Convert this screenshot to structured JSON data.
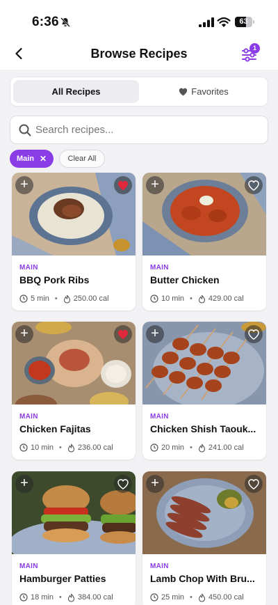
{
  "status_bar": {
    "time": "6:36",
    "battery": "63",
    "battery_level": 0.63
  },
  "nav": {
    "title": "Browse Recipes",
    "filter_count": "1"
  },
  "segment": {
    "all_label": "All Recipes",
    "favorites_label": "Favorites"
  },
  "search": {
    "placeholder": "Search recipes..."
  },
  "filters": {
    "active_chip": "Main",
    "clear_label": "Clear All"
  },
  "colors": {
    "accent": "#8a3ce6",
    "favorite": "#e0283c"
  },
  "recipes": [
    {
      "category": "MAIN",
      "name": "BBQ Pork Ribs",
      "time": "5 min",
      "calories": "250.00 cal",
      "favorited": true
    },
    {
      "category": "MAIN",
      "name": "Butter Chicken",
      "time": "10 min",
      "calories": "429.00 cal",
      "favorited": false
    },
    {
      "category": "MAIN",
      "name": "Chicken Fajitas",
      "time": "10 min",
      "calories": "236.00 cal",
      "favorited": true
    },
    {
      "category": "MAIN",
      "name": "Chicken Shish Taouk...",
      "time": "20 min",
      "calories": "241.00 cal",
      "favorited": false
    },
    {
      "category": "MAIN",
      "name": "Hamburger Patties",
      "time": "18 min",
      "calories": "384.00 cal",
      "favorited": false
    },
    {
      "category": "MAIN",
      "name": "Lamb Chop With Bru...",
      "time": "25 min",
      "calories": "450.00 cal",
      "favorited": false
    }
  ]
}
